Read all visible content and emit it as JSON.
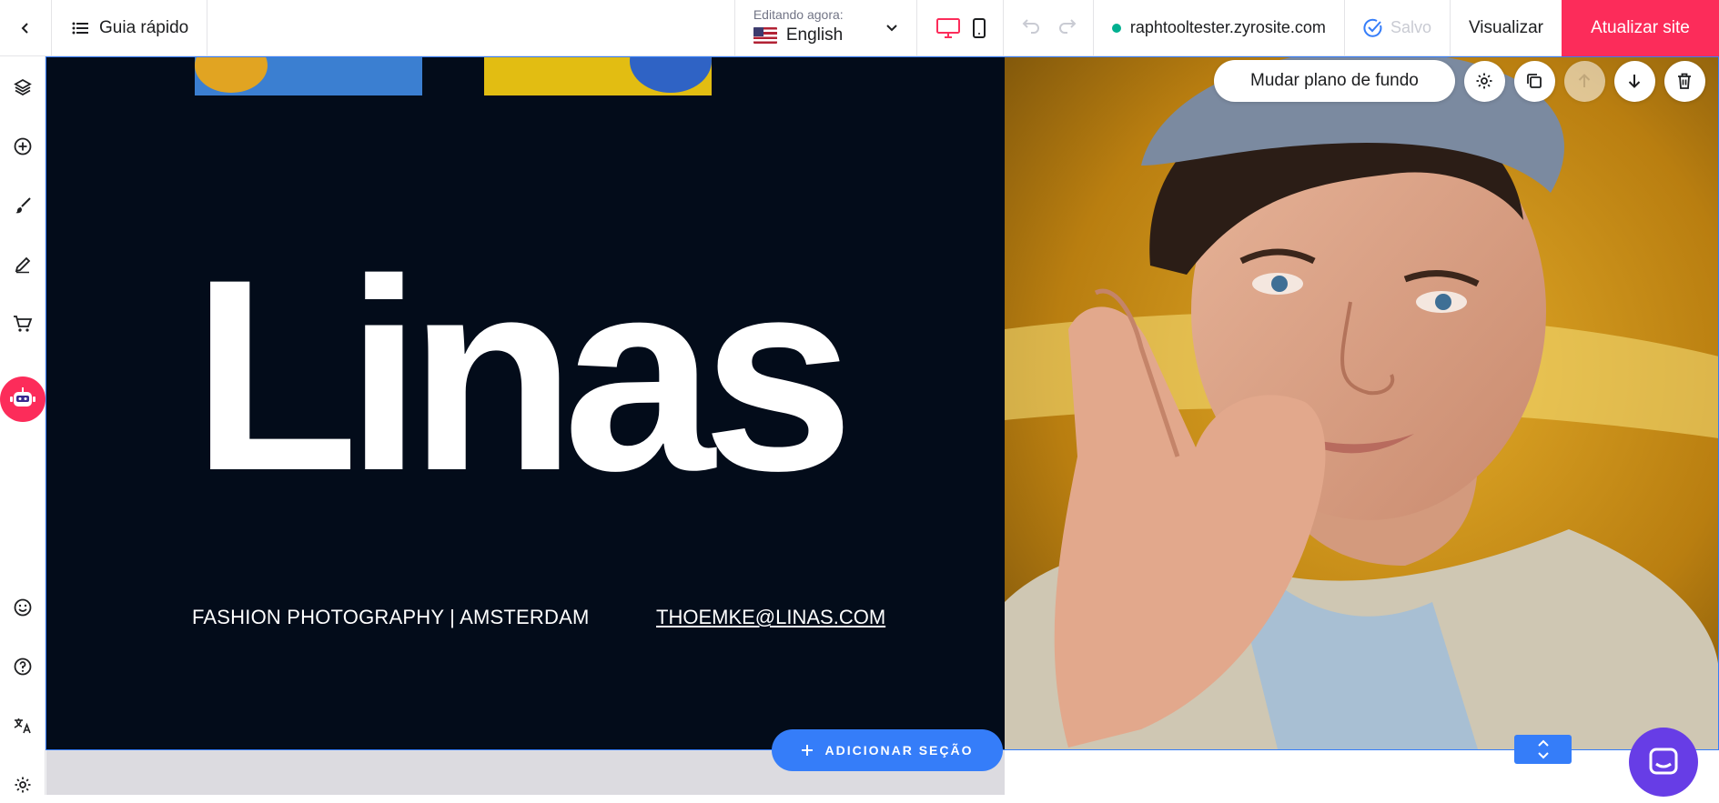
{
  "topbar": {
    "back_icon": "chevron-left-icon",
    "guide_label": "Guia rápido",
    "editing_label": "Editando agora:",
    "language": "English",
    "domain": "raphtooltester.zyrosite.com",
    "saved_label": "Salvo",
    "preview_label": "Visualizar",
    "update_label": "Atualizar site"
  },
  "sidebar": {
    "items": [
      {
        "icon": "layers-icon"
      },
      {
        "icon": "add-element-icon"
      },
      {
        "icon": "brush-icon"
      },
      {
        "icon": "pen-icon"
      },
      {
        "icon": "cart-icon"
      },
      {
        "icon": "ai-assistant-icon"
      },
      {
        "icon": "smiley-icon"
      },
      {
        "icon": "help-icon"
      },
      {
        "icon": "translate-icon"
      },
      {
        "icon": "settings-icon"
      }
    ]
  },
  "section": {
    "change_background_label": "Mudar plano de fundo",
    "add_section_label": "ADICIONAR SEÇÃO"
  },
  "hero": {
    "logo_text": "Linas",
    "tagline": "FASHION PHOTOGRAPHY | AMSTERDAM",
    "email": "THOEMKE@LINAS.COM"
  },
  "colors": {
    "accent": "#fc2c5a",
    "selection": "#357df9",
    "hero_bg": "#030c1a",
    "chat": "#673de6"
  }
}
